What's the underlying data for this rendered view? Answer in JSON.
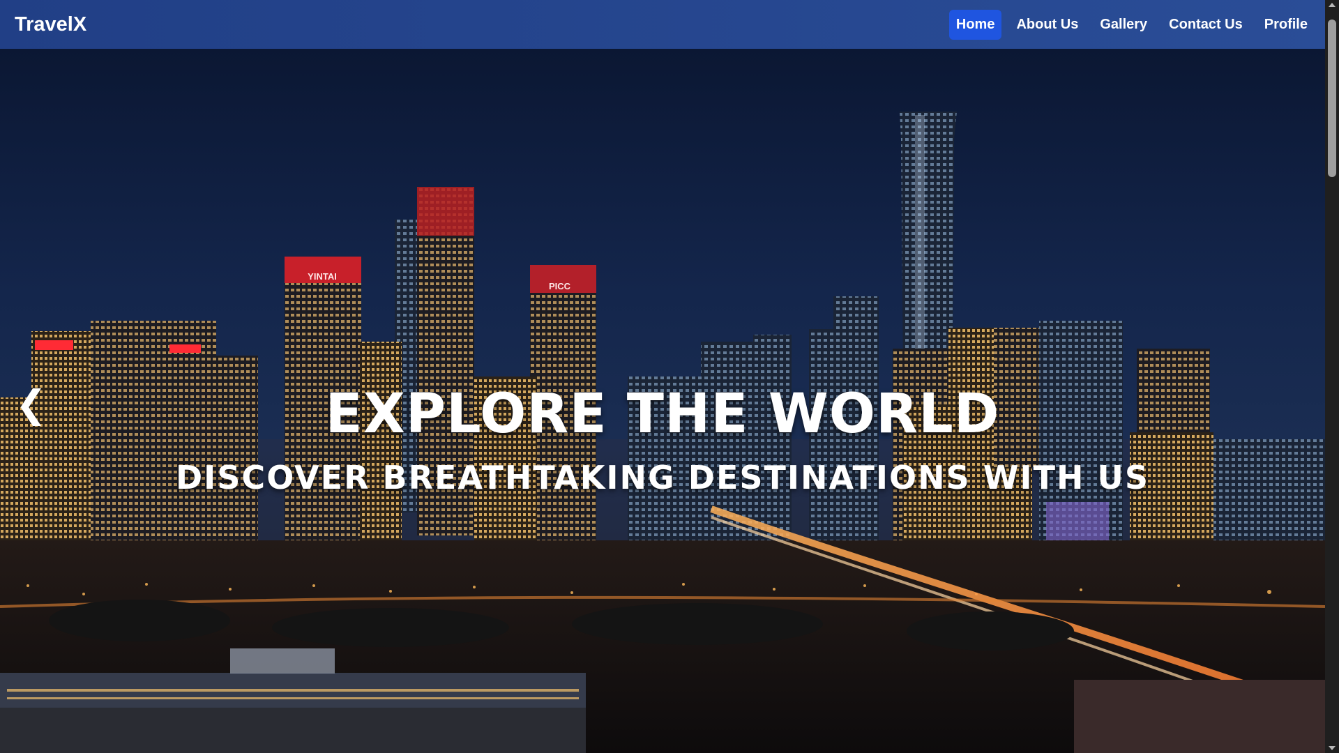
{
  "brand": "TravelX",
  "nav": {
    "items": [
      {
        "label": "Home",
        "active": true
      },
      {
        "label": "About Us",
        "active": false
      },
      {
        "label": "Gallery",
        "active": false
      },
      {
        "label": "Contact Us",
        "active": false
      },
      {
        "label": "Profile",
        "active": false
      }
    ]
  },
  "hero": {
    "title": "EXPLORE THE WORLD",
    "subtitle": "DISCOVER BREATHTAKING DESTINATIONS WITH US",
    "prev_icon": "chevron-left-icon",
    "prev_glyph": "❮",
    "image_subject": "city skyline at night",
    "building_signs": [
      "YINTAI",
      "PICC"
    ]
  },
  "colors": {
    "nav_bg": "#2a4d97",
    "nav_active_bg": "#1f55e0",
    "text": "#ffffff"
  }
}
